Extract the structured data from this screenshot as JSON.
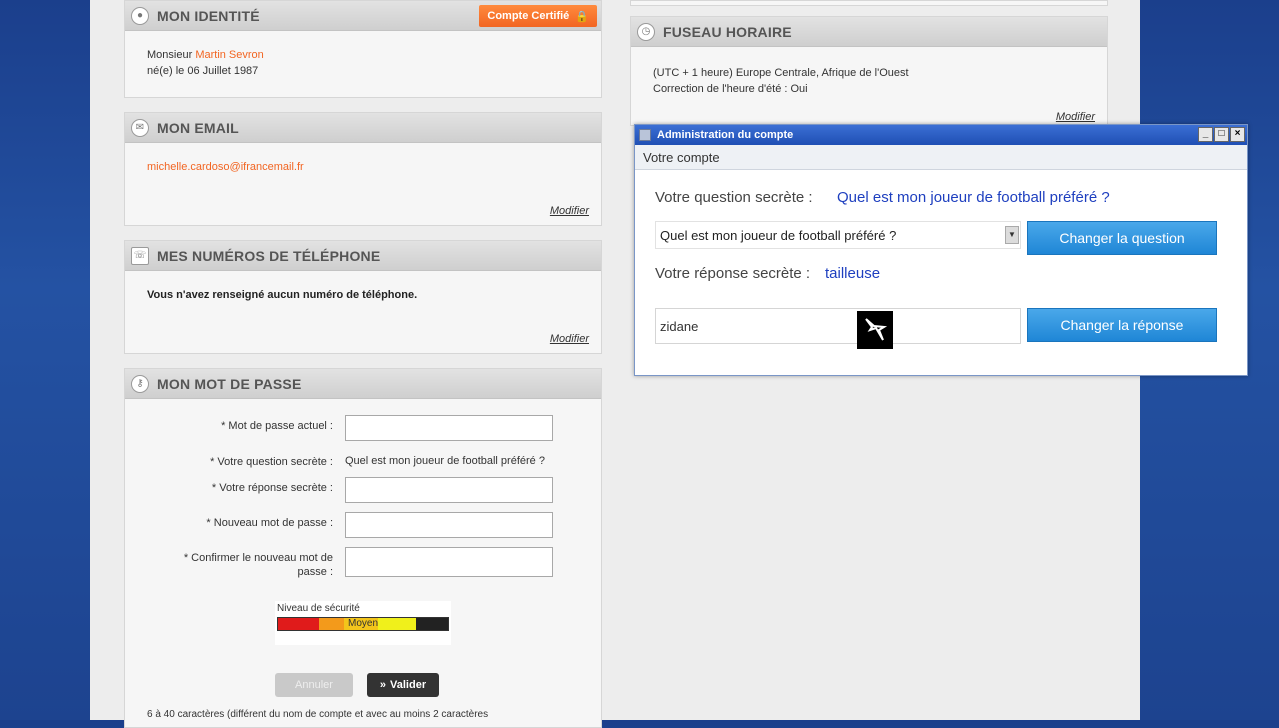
{
  "identity": {
    "title": "MON IDENTITÉ",
    "badge": "Compte Certifié",
    "civility": "Monsieur",
    "name": "Martin Sevron",
    "birth": "né(e) le 06 Juillet 1987"
  },
  "email": {
    "title": "MON EMAIL",
    "address": "michelle.cardoso@ifrancemail.fr",
    "modify": "Modifier"
  },
  "phone": {
    "title": "MES NUMÉROS DE TÉLÉPHONE",
    "message": "Vous n'avez renseigné aucun numéro de téléphone.",
    "modify": "Modifier"
  },
  "password": {
    "title": "MON MOT DE PASSE",
    "current_label": "* Mot de passe actuel :",
    "question_label": "* Votre question secrète :",
    "question_value": "Quel est mon joueur de football préféré ?",
    "answer_label": "* Votre réponse secrète :",
    "new_label": "* Nouveau mot de passe :",
    "confirm_label_1": "* Confirmer le nouveau mot de",
    "confirm_label_2": "passe :",
    "meter_label": "Niveau de sécurité",
    "meter_value": "Moyen",
    "cancel": "Annuler",
    "submit": "Valider",
    "footnote": "6 à 40 caractères (différent du nom de compte et avec au moins 2 caractères"
  },
  "timezone": {
    "title": "FUSEAU HORAIRE",
    "line1": "(UTC + 1 heure) Europe Centrale, Afrique de l'Ouest",
    "line2": "Correction de l'heure d'été : Oui",
    "modify": "Modifier"
  },
  "dialog": {
    "window_title": "Administration du compte",
    "subtitle": "Votre compte",
    "question_label": "Votre question secrète :",
    "question_value": "Quel est mon joueur de football préféré ?",
    "select_value": "Quel est mon joueur de football préféré ?",
    "change_question": "Changer la question",
    "answer_label": "Votre réponse secrète :",
    "answer_value": "tailleuse",
    "input_value": "zidane",
    "change_answer": "Changer la réponse"
  },
  "colors": {
    "accent": "#f26522",
    "link_blue": "#1e3fbf",
    "button_blue": "#1f86d6"
  }
}
